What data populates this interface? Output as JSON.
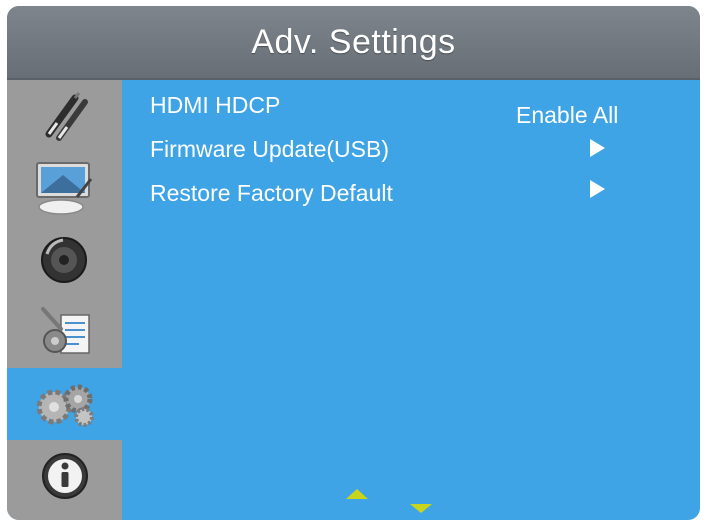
{
  "header": {
    "title": "Adv. Settings"
  },
  "sidebar": {
    "items": [
      {
        "icon": "picture-brushes-icon",
        "active": false
      },
      {
        "icon": "screen-display-icon",
        "active": false
      },
      {
        "icon": "audio-speaker-icon",
        "active": false
      },
      {
        "icon": "setup-tools-icon",
        "active": false
      },
      {
        "icon": "advanced-gears-icon",
        "active": true
      },
      {
        "icon": "info-icon",
        "active": false
      }
    ]
  },
  "menu": {
    "rows": [
      {
        "label": "HDMI HDCP",
        "value": "Enable All"
      },
      {
        "label": "Firmware Update(USB)",
        "value": ""
      },
      {
        "label": "Restore Factory Default",
        "value": ""
      }
    ]
  },
  "nav": {
    "up": "up-arrow-icon",
    "down": "down-arrow-icon"
  },
  "colors": {
    "panel_bg": "#3fa4e6",
    "header_bg": "#737a81",
    "sidebar_bg": "#9b9b9b",
    "nav_arrow": "#c9d51b",
    "text": "#ffffff"
  }
}
